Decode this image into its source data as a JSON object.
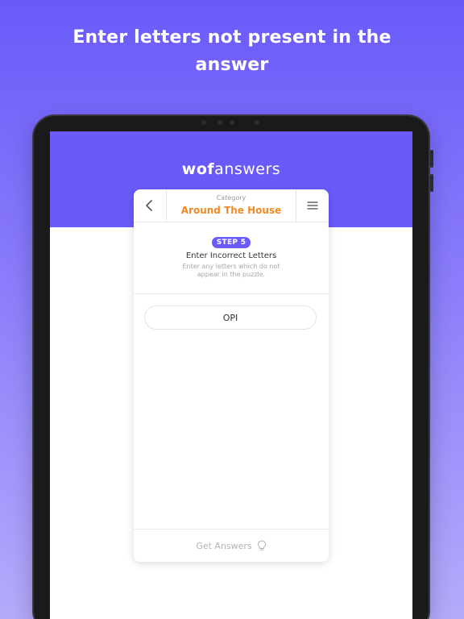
{
  "headline": {
    "line1": "Enter letters not present in the",
    "line2": "answer"
  },
  "app": {
    "brand_bold": "wof",
    "brand_light": "answers",
    "header_color": "#6a5af9"
  },
  "card": {
    "back_icon": "chevron-left-icon",
    "menu_icon": "hamburger-menu-icon",
    "category_label": "Category",
    "category_value": "Around The House",
    "category_color": "#f08a24"
  },
  "step": {
    "badge": "STEP 5",
    "title": "Enter Incorrect Letters",
    "description": "Enter any letters which do not appear in the puzzle."
  },
  "input": {
    "value": "OPI"
  },
  "footer": {
    "button_label": "Get Answers",
    "icon": "lightbulb-icon"
  }
}
